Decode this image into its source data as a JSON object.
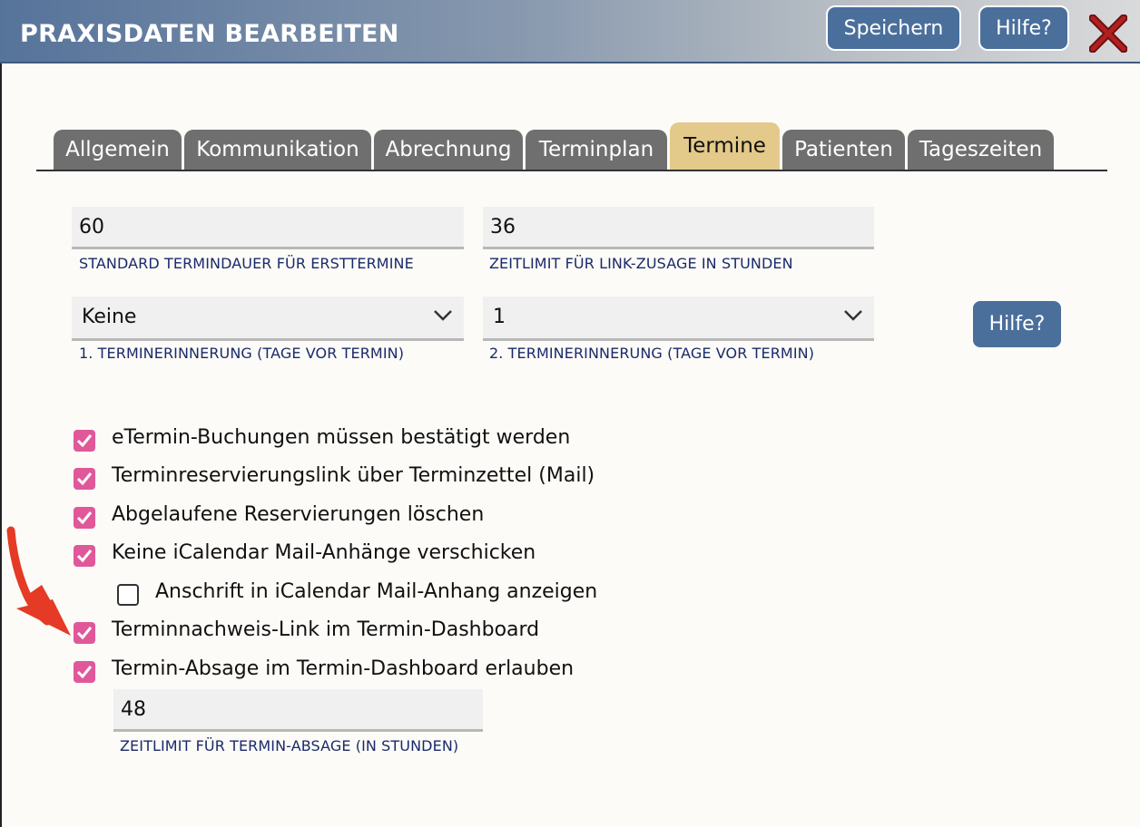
{
  "window": {
    "title": "PRAXISDATEN BEARBEITEN",
    "save_label": "Speichern",
    "help_label": "Hilfe?"
  },
  "tabs": [
    {
      "label": "Allgemein",
      "active": false
    },
    {
      "label": "Kommunikation",
      "active": false
    },
    {
      "label": "Abrechnung",
      "active": false
    },
    {
      "label": "Terminplan",
      "active": false
    },
    {
      "label": "Termine",
      "active": true
    },
    {
      "label": "Patienten",
      "active": false
    },
    {
      "label": "Tageszeiten",
      "active": false
    }
  ],
  "form": {
    "standard_duration": {
      "value": "60",
      "label": "STANDARD TERMINDAUER FÜR ERSTTERMINE"
    },
    "link_timeout": {
      "value": "36",
      "label": "ZEITLIMIT FÜR LINK-ZUSAGE IN STUNDEN"
    },
    "reminder1": {
      "value": "Keine",
      "label": "1. TERMINERINNERUNG (TAGE VOR TERMIN)"
    },
    "reminder2": {
      "value": "1",
      "label": "2. TERMINERINNERUNG (TAGE VOR TERMIN)"
    },
    "help_label": "Hilfe?",
    "checkboxes": [
      {
        "label": "eTermin-Buchungen müssen bestätigt werden",
        "checked": true
      },
      {
        "label": "Terminreservierungslink über Terminzettel (Mail)",
        "checked": true
      },
      {
        "label": "Abgelaufene Reservierungen löschen",
        "checked": true
      },
      {
        "label": "Keine iCalendar Mail-Anhänge verschicken",
        "checked": true
      },
      {
        "label": "Anschrift in iCalendar Mail-Anhang anzeigen",
        "checked": false
      },
      {
        "label": "Terminnachweis-Link im Termin-Dashboard",
        "checked": true
      },
      {
        "label": "Termin-Absage im Termin-Dashboard erlauben",
        "checked": true
      }
    ],
    "cancel_timeout": {
      "value": "48",
      "label": "ZEITLIMIT FÜR TERMIN-ABSAGE (IN STUNDEN)"
    }
  },
  "colors": {
    "checkbox_checked": "#e0589a",
    "button": "#4a6f9b",
    "active_tab": "#e3c98a",
    "tab": "#6f6f6f",
    "close": "#9b1c1c",
    "annotation_arrow": "#e53a25"
  }
}
